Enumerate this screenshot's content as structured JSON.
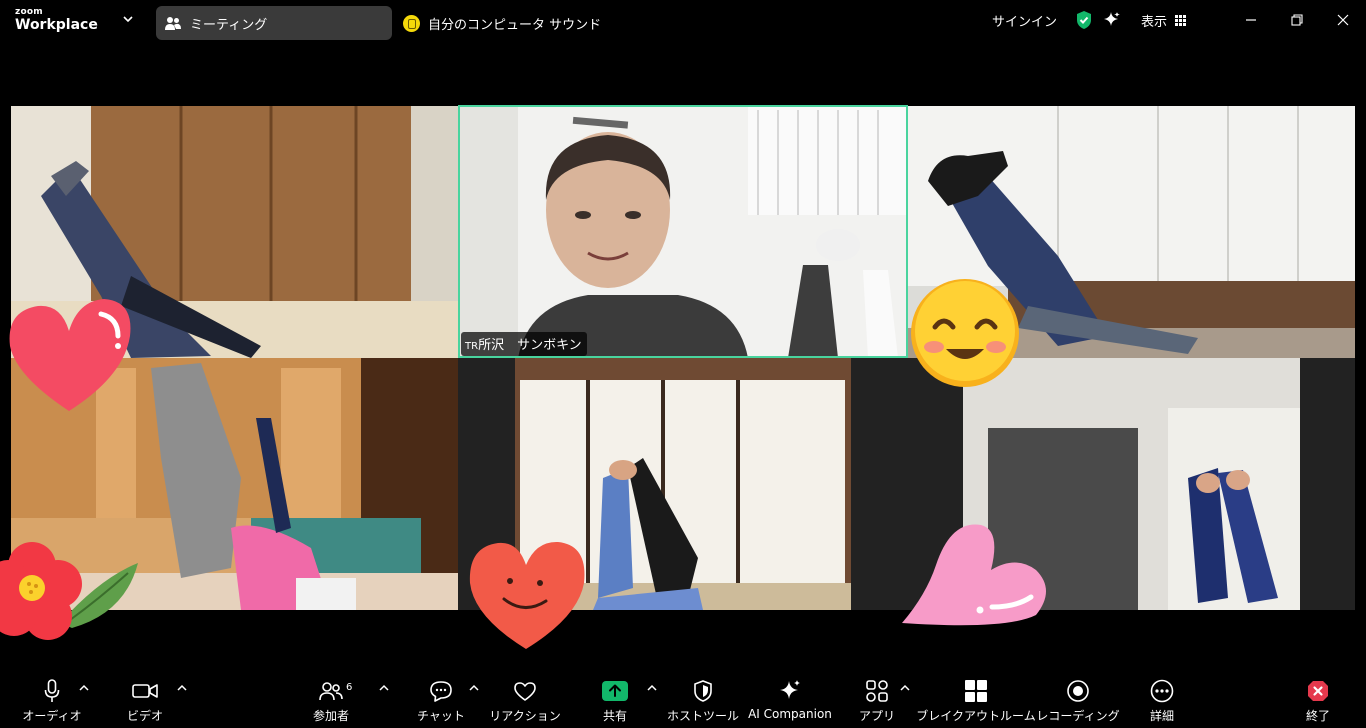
{
  "app": {
    "logo_top": "zoom",
    "logo_bottom": "Workplace"
  },
  "tabs": {
    "meeting": "ミーティング",
    "sound": "自分のコンピュータ サウンド"
  },
  "top_right": {
    "signin": "サインイン",
    "view": "表示"
  },
  "participants": [
    {
      "name_prefix": "",
      "name": ""
    },
    {
      "name_prefix": "TR",
      "name": "所沢　サンボキン"
    },
    {
      "name_prefix": "",
      "name": ""
    },
    {
      "name_prefix": "",
      "name": ""
    },
    {
      "name_prefix": "",
      "name": ""
    },
    {
      "name_prefix": "",
      "name": ""
    }
  ],
  "toolbar": {
    "audio": "オーディオ",
    "video": "ビデオ",
    "participants": "参加者",
    "participants_count": "6",
    "chat": "チャット",
    "reactions": "リアクション",
    "share": "共有",
    "host_tools": "ホストツール",
    "ai_companion": "AI Companion",
    "apps": "アプリ",
    "breakout": "ブレイクアウトルーム",
    "recording": "レコーディング",
    "more": "詳細",
    "end": "終了"
  },
  "colors": {
    "active_speaker": "#49d49e",
    "share_green": "#12b76a",
    "end_red": "#e5394d",
    "tab_bg": "#3a3a3a",
    "shield_green": "#12b76a"
  },
  "icons": [
    "chevron-down-icon",
    "participants-icon",
    "sound-icon",
    "shield-check-icon",
    "sparkle-icon",
    "grid-icon",
    "minimize-icon",
    "restore-icon",
    "close-icon",
    "microphone-icon",
    "camera-icon",
    "chat-icon",
    "heart-icon",
    "share-arrow-icon",
    "host-shield-icon",
    "ai-sparkle-icon",
    "apps-icon",
    "breakout-icon",
    "record-icon",
    "more-icon",
    "end-icon"
  ]
}
